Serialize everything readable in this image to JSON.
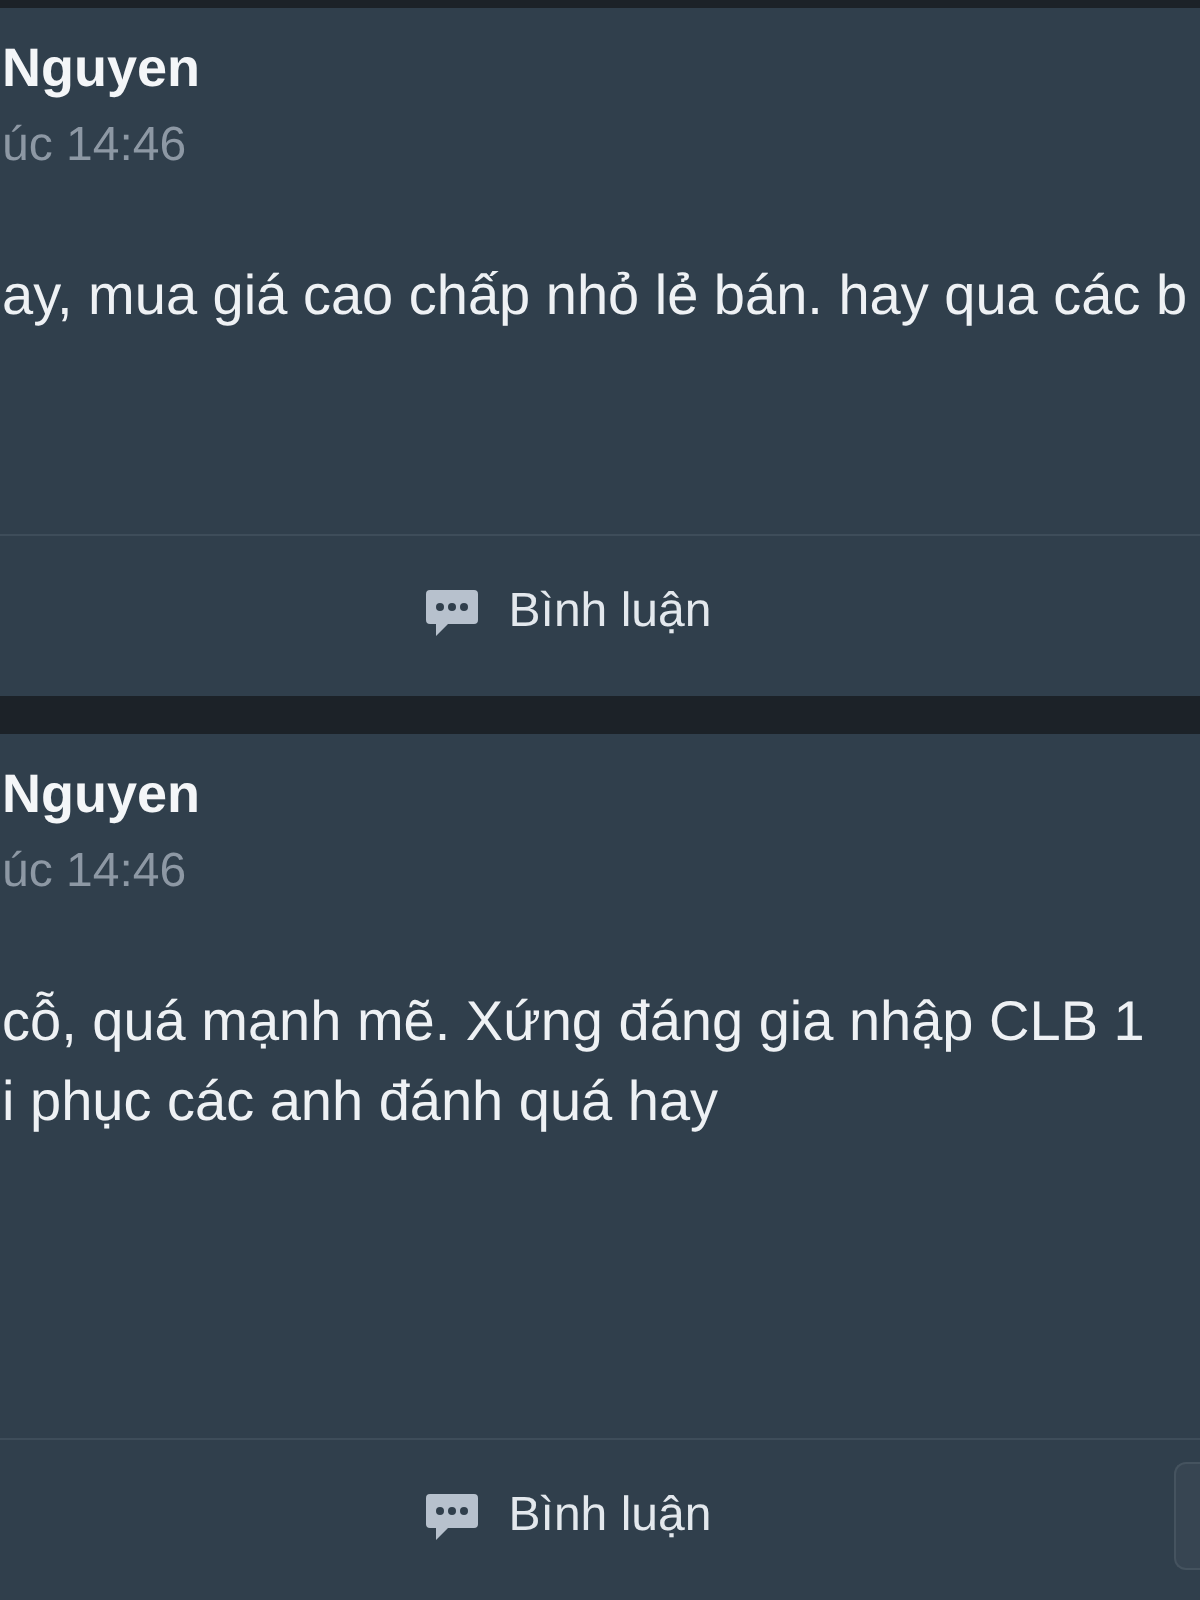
{
  "posts": [
    {
      "author": "Nguyen",
      "time": "úc 14:46",
      "text_lines": [
        "ay, mua giá cao chấp nhỏ lẻ bán. hay qua các b"
      ],
      "action": {
        "label": "Bình luận"
      }
    },
    {
      "author": "Nguyen",
      "time": "úc 14:46",
      "text_lines": [
        "cỗ, quá mạnh mẽ. Xứng đáng gia nhập CLB 1",
        "i phục các anh đánh quá hay"
      ],
      "action": {
        "label": "Bình luận"
      }
    }
  ]
}
